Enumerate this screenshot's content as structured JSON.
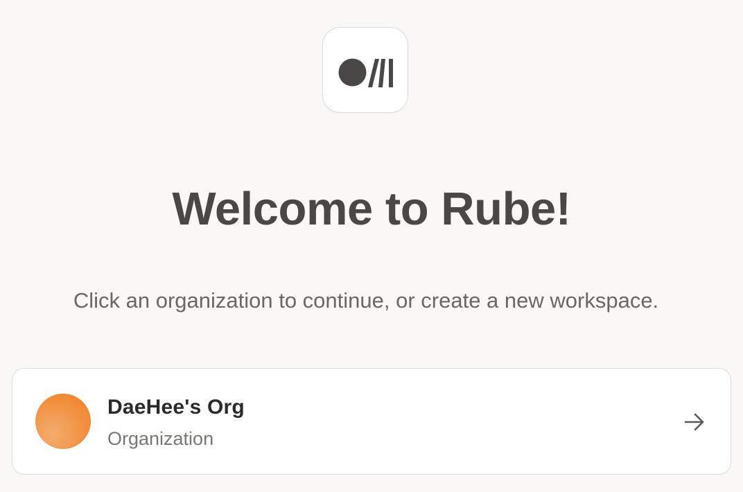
{
  "header": {
    "logo_icon": "rube-logo-icon",
    "title": "Welcome to Rube!",
    "subtitle": "Click an organization to continue, or create a new workspace."
  },
  "organizations": [
    {
      "name": "DaeHee's Org",
      "type": "Organization",
      "avatar_icon": "gradient-avatar",
      "action_icon": "arrow-right-icon"
    }
  ],
  "colors": {
    "background": "#faf8f6",
    "title": "#4a4846",
    "avatar_orange": "#f07d1f"
  }
}
